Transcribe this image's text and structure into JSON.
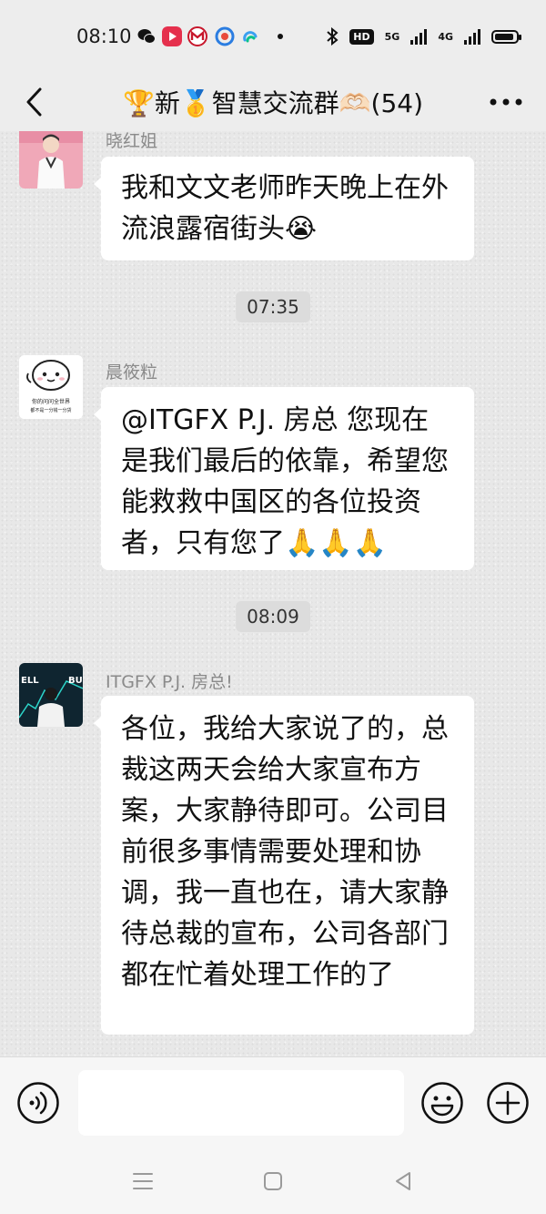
{
  "status_bar": {
    "time": "08:10",
    "hd_label": "HD",
    "network_1": "5G",
    "network_2": "4G",
    "battery_level": 0.9
  },
  "header": {
    "title": "🏆新🥇智慧交流群🫶🏻(54)"
  },
  "messages": [
    {
      "sender": "晓红姐",
      "text": "我和文文老师昨天晚上在外流浪露宿街头😭"
    },
    {
      "timestamp": "07:35"
    },
    {
      "sender": "晨筱粒",
      "text": "@ITGFX P.J. 房总  您现在是我们最后的依靠，希望您能救救中国区的各位投资者，只有您了🙏🙏🙏",
      "avatar_caption_1": "你的问问全世界",
      "avatar_caption_2": "都不是一分钱一分货"
    },
    {
      "timestamp": "08:09"
    },
    {
      "sender": "ITGFX P.J. 房总!",
      "text": "各位，我给大家说了的，总裁这两天会给大家宣布方案，大家静待即可。公司目前很多事情需要处理和协调，我一直也在，请大家静待总裁的宣布，公司各部门都在忙着处理工作的了",
      "avatar_labels": [
        "ELL",
        "BU"
      ]
    }
  ],
  "input_bar": {
    "placeholder": ""
  },
  "icons": {
    "back": "back-arrow-icon",
    "more": "more-dots-icon",
    "voice": "voice-icon",
    "emoji": "emoji-icon",
    "plus": "plus-icon",
    "nav_menu": "nav-menu-icon",
    "nav_home": "nav-home-icon",
    "nav_back": "nav-back-icon"
  },
  "colors": {
    "background": "#ededed",
    "bubble": "#ffffff",
    "sender_name": "#8a8a8a"
  }
}
